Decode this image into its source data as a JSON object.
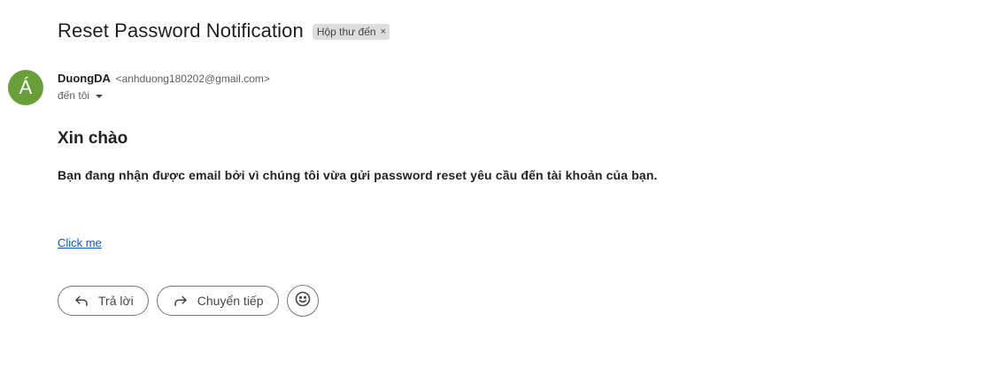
{
  "email": {
    "subject": "Reset Password Notification",
    "label": "Hộp thư đến",
    "label_close": "×",
    "sender": {
      "avatar_letter": "Á",
      "avatar_color": "#689f38",
      "name": "DuongDA",
      "email": "<anhduong180202@gmail.com>"
    },
    "recipient": "đến tôi",
    "body": {
      "greeting": "Xin chào",
      "message": "Bạn đang nhận được email bởi vì chúng tôi vừa gửi password reset yêu cầu đến tài khoản của bạn.",
      "link_text": "Click me"
    }
  },
  "actions": {
    "reply_label": "Trả lời",
    "forward_label": "Chuyển tiếp",
    "reply_icon": "reply-icon",
    "forward_icon": "forward-icon",
    "emoji_icon": "emoji-icon"
  },
  "colors": {
    "link": "#1155cc",
    "chip_bg": "#dddddd"
  }
}
